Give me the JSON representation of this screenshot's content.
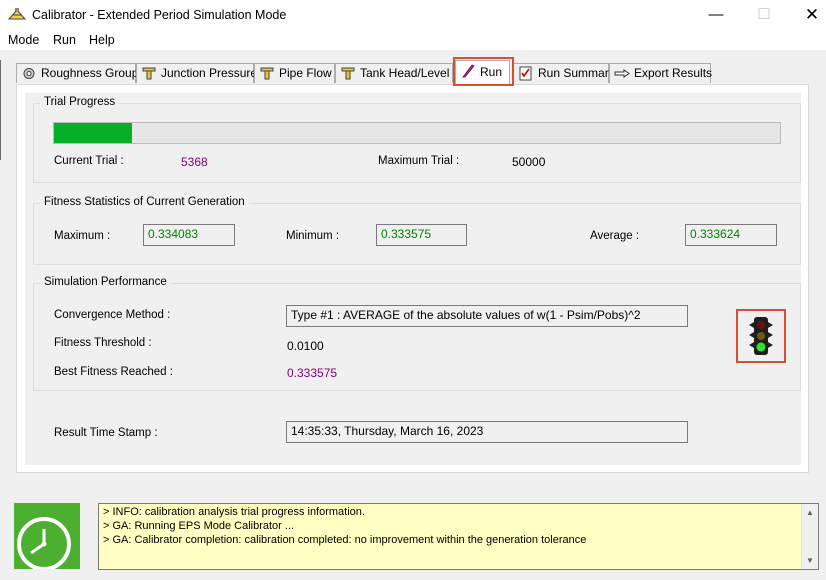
{
  "window": {
    "title": "Calibrator - Extended Period Simulation Mode",
    "icon": "calibrator-app-icon",
    "controls": {
      "minimize": "—",
      "maximize": "☐",
      "close": "✕"
    }
  },
  "menu": [
    "Mode",
    "Run",
    "Help"
  ],
  "tabs": [
    {
      "label": "Roughness Group",
      "icon": "gear-icon"
    },
    {
      "label": "Junction Pressure",
      "icon": "pipe-fitting-icon"
    },
    {
      "label": "Pipe Flow",
      "icon": "pipe-fitting-icon"
    },
    {
      "label": "Tank Head/Level",
      "icon": "pipe-fitting-icon"
    },
    {
      "label": "Run",
      "icon": "quill-pen-icon",
      "active": true
    },
    {
      "label": "Run Summary",
      "icon": "checklist-icon"
    },
    {
      "label": "Export Results",
      "icon": "pointing-hand-icon"
    }
  ],
  "trial_progress": {
    "title": "Trial Progress",
    "progress_fraction": 0.1074,
    "current_label": "Current Trial :",
    "current_value": "5368",
    "max_label": "Maximum Trial :",
    "max_value": "50000"
  },
  "fitness": {
    "title": "Fitness Statistics of Current Generation",
    "maximum_label": "Maximum :",
    "maximum_value": "0.334083",
    "minimum_label": "Minimum :",
    "minimum_value": "0.333575",
    "average_label": "Average :",
    "average_value": "0.333624"
  },
  "performance": {
    "title": "Simulation Performance",
    "convergence_label": "Convergence Method :",
    "convergence_value": "Type #1 :  AVERAGE of the absolute values of w(1 - Psim/Pobs)^2",
    "threshold_label": "Fitness Threshold :",
    "threshold_value": "0.0100",
    "best_label": "Best Fitness Reached :",
    "best_value": "0.333575",
    "status_icon": "traffic-light-icon",
    "status_light": "green"
  },
  "timestamp": {
    "label": "Result Time Stamp :",
    "value": "14:35:33, Thursday, March 16, 2023"
  },
  "log": [
    "> INFO: calibration analysis trial progress information.",
    "> GA: Running EPS Mode Calibrator ...",
    "> GA: Calibrator completion: calibration completed: no improvement within the generation tolerance"
  ],
  "colors": {
    "progress_fill": "#06b025",
    "highlight": "#d4502e",
    "log_background": "#ffffc4",
    "status_tile": "#4caf2f"
  }
}
